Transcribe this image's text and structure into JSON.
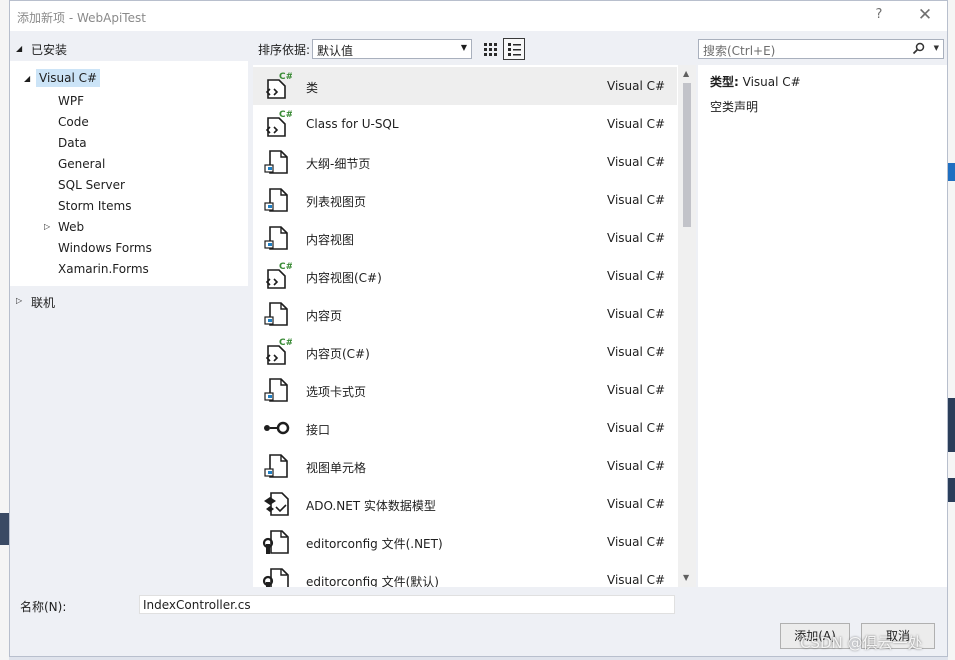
{
  "window": {
    "title": "添加新项 - WebApiTest",
    "help": "?",
    "close": "✕"
  },
  "tree": {
    "installed": "已安装",
    "language": "Visual C#",
    "children": [
      "WPF",
      "Code",
      "Data",
      "General",
      "SQL Server",
      "Storm Items",
      "Web",
      "Windows Forms",
      "Xamarin.Forms"
    ],
    "online": "联机"
  },
  "toolbar": {
    "sort_label": "排序依据:",
    "sort_value": "默认值",
    "search_placeholder": "搜索(Ctrl+E)"
  },
  "items": [
    {
      "name": "类",
      "lang": "Visual C#",
      "icon": "csharp-file-icon",
      "selected": true
    },
    {
      "name": "Class for U-SQL",
      "lang": "Visual C#",
      "icon": "csharp-file-icon"
    },
    {
      "name": "大纲-细节页",
      "lang": "Visual C#",
      "icon": "xaml-page-icon"
    },
    {
      "name": "列表视图页",
      "lang": "Visual C#",
      "icon": "xaml-page-icon"
    },
    {
      "name": "内容视图",
      "lang": "Visual C#",
      "icon": "xaml-page-icon"
    },
    {
      "name": "内容视图(C#)",
      "lang": "Visual C#",
      "icon": "csharp-file-icon"
    },
    {
      "name": "内容页",
      "lang": "Visual C#",
      "icon": "xaml-page-icon"
    },
    {
      "name": "内容页(C#)",
      "lang": "Visual C#",
      "icon": "csharp-file-icon"
    },
    {
      "name": "选项卡式页",
      "lang": "Visual C#",
      "icon": "xaml-page-icon"
    },
    {
      "name": "接口",
      "lang": "Visual C#",
      "icon": "interface-icon"
    },
    {
      "name": "视图单元格",
      "lang": "Visual C#",
      "icon": "xaml-page-icon"
    },
    {
      "name": "ADO.NET 实体数据模型",
      "lang": "Visual C#",
      "icon": "entity-model-icon"
    },
    {
      "name": "editorconfig 文件(.NET)",
      "lang": "Visual C#",
      "icon": "config-file-icon"
    },
    {
      "name": "editorconfig 文件(默认)",
      "lang": "Visual C#",
      "icon": "config-file-icon"
    }
  ],
  "details": {
    "type_label": "类型:",
    "type_value": "Visual C#",
    "description": "空类声明"
  },
  "footer": {
    "name_label": "名称(N):",
    "name_value": "IndexController.cs",
    "add_label": "添加(A)",
    "cancel_label": "取消"
  },
  "watermark": "CSDN @俱云一处",
  "colors": {
    "selection": "#cce4f7",
    "accent": "#1f6fc1",
    "csharp_badge": "#388a34"
  }
}
